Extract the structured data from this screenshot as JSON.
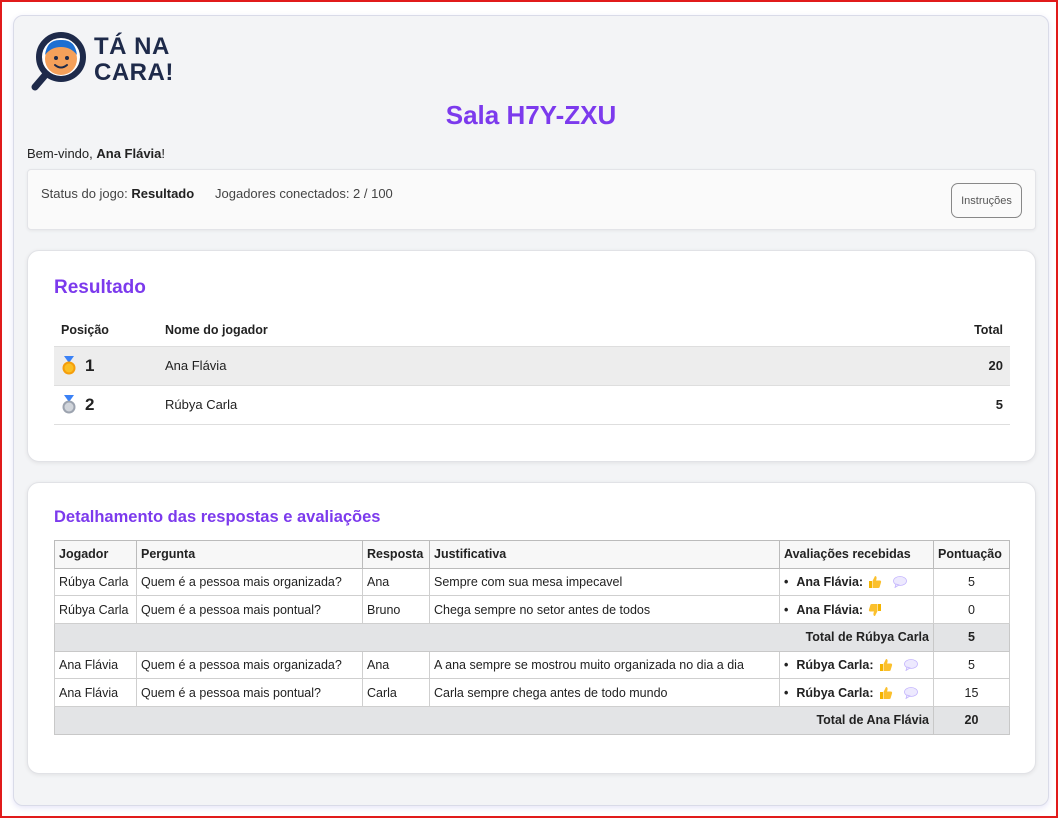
{
  "logo": {
    "line1": "TÁ NA",
    "line2": "CARA!"
  },
  "room": {
    "title": "Sala H7Y-ZXU"
  },
  "welcome": {
    "prefix": "Bem-vindo, ",
    "name": "Ana Flávia",
    "suffix": "!"
  },
  "status": {
    "status_label": "Status do jogo: ",
    "status_value": "Resultado",
    "players_label": "Jogadores conectados: 2 / 100",
    "instructions_button": "Instruções"
  },
  "results": {
    "title": "Resultado",
    "headers": {
      "position": "Posição",
      "name": "Nome do jogador",
      "total": "Total"
    },
    "rows": [
      {
        "position": "1",
        "name": "Ana Flávia",
        "total": "20",
        "medal": "gold"
      },
      {
        "position": "2",
        "name": "Rúbya Carla",
        "total": "5",
        "medal": "silver"
      }
    ]
  },
  "details": {
    "title": "Detalhamento das respostas e avaliações",
    "headers": {
      "player": "Jogador",
      "question": "Pergunta",
      "answer": "Resposta",
      "justification": "Justificativa",
      "evaluations": "Avaliações recebidas",
      "score": "Pontuação"
    },
    "groups": [
      {
        "rows": [
          {
            "player": "Rúbya Carla",
            "question": "Quem é a pessoa mais organizada?",
            "answer": "Ana",
            "justification": "Sempre com sua mesa impecavel",
            "evaluator": "Ana Flávia:",
            "vote": "thumbs-up",
            "comment": true,
            "score": "5"
          },
          {
            "player": "Rúbya Carla",
            "question": "Quem é a pessoa mais pontual?",
            "answer": "Bruno",
            "justification": "Chega sempre no setor antes de todos",
            "evaluator": "Ana Flávia:",
            "vote": "thumbs-down",
            "comment": false,
            "score": "0"
          }
        ],
        "total_label": "Total de Rúbya Carla",
        "total_value": "5"
      },
      {
        "rows": [
          {
            "player": "Ana Flávia",
            "question": "Quem é a pessoa mais organizada?",
            "answer": "Ana",
            "justification": "A ana sempre se mostrou muito organizada no dia a dia",
            "evaluator": "Rúbya Carla:",
            "vote": "thumbs-up",
            "comment": true,
            "score": "5"
          },
          {
            "player": "Ana Flávia",
            "question": "Quem é a pessoa mais pontual?",
            "answer": "Carla",
            "justification": "Carla sempre chega antes de todo mundo",
            "evaluator": "Rúbya Carla:",
            "vote": "thumbs-up",
            "comment": true,
            "score": "15"
          }
        ],
        "total_label": "Total de Ana Flávia",
        "total_value": "20"
      }
    ]
  },
  "colors": {
    "accent": "#7c3aed",
    "logo_dark": "#1e2a4a",
    "thumb": "#f4b400",
    "medal_gold": "#f59e0b",
    "medal_silver": "#9ca3af"
  }
}
